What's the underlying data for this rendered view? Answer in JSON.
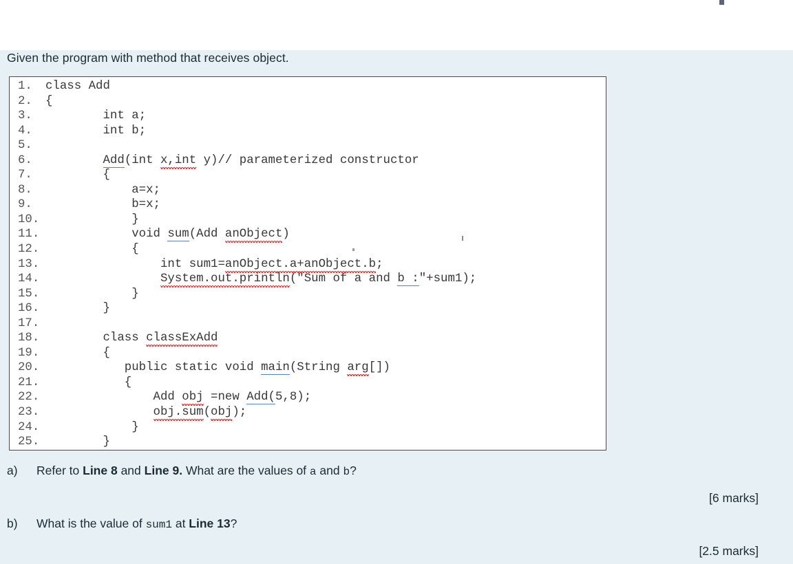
{
  "document": {
    "prompt": "Given the program with method that receives object.",
    "background_color": "#e7f1f5",
    "code_box": {
      "border_color": "#4a4a4a",
      "background_color": "#ffffff",
      "spellcheck_underline_color": "#e03a3a",
      "link_underline_color": "#4f7fc4",
      "lines": [
        {
          "num": "1.",
          "code": "class Add"
        },
        {
          "num": "2.",
          "code": "{"
        },
        {
          "num": "3.",
          "code": "        int a;"
        },
        {
          "num": "4.",
          "code": "        int b;"
        },
        {
          "num": "5.",
          "code": ""
        },
        {
          "num": "6.",
          "code": "        Add(int x,int y)// parameterized constructor"
        },
        {
          "num": "7.",
          "code": "        {"
        },
        {
          "num": "8.",
          "code": "            a=x;"
        },
        {
          "num": "9.",
          "code": "            b=x;"
        },
        {
          "num": "10.",
          "code": "            }"
        },
        {
          "num": "11.",
          "code": "            void sum(Add anObject)"
        },
        {
          "num": "12.",
          "code": "            {"
        },
        {
          "num": "13.",
          "code": "                int sum1=anObject.a+anObject.b;"
        },
        {
          "num": "14.",
          "code": "                System.out.println(\"Sum of a and b :\"+sum1);"
        },
        {
          "num": "15.",
          "code": "            }"
        },
        {
          "num": "16.",
          "code": "        }"
        },
        {
          "num": "17.",
          "code": ""
        },
        {
          "num": "18.",
          "code": "        class classExAdd"
        },
        {
          "num": "19.",
          "code": "        {"
        },
        {
          "num": "20.",
          "code": "           public static void main(String arg[])"
        },
        {
          "num": "21.",
          "code": "           {"
        },
        {
          "num": "22.",
          "code": "               Add obj =new Add(5,8);"
        },
        {
          "num": "23.",
          "code": "               obj.sum(obj);"
        },
        {
          "num": "24.",
          "code": "            }"
        },
        {
          "num": "25.",
          "code": "        }"
        }
      ]
    },
    "questions": [
      {
        "label": "a)",
        "parts": [
          {
            "text": "Refer to ",
            "style": "normal"
          },
          {
            "text": "Line 8",
            "style": "bold"
          },
          {
            "text": " and ",
            "style": "normal"
          },
          {
            "text": "Line 9.",
            "style": "bold"
          },
          {
            "text": " What are the values of ",
            "style": "normal"
          },
          {
            "text": "a",
            "style": "mono"
          },
          {
            "text": " and ",
            "style": "normal"
          },
          {
            "text": "b",
            "style": "mono"
          },
          {
            "text": "?",
            "style": "normal"
          }
        ],
        "marks": "[6 marks]"
      },
      {
        "label": "b)",
        "parts": [
          {
            "text": "What is the value of ",
            "style": "normal"
          },
          {
            "text": "sum1",
            "style": "mono"
          },
          {
            "text": " at ",
            "style": "normal"
          },
          {
            "text": "Line 13",
            "style": "bold"
          },
          {
            "text": "?",
            "style": "normal"
          }
        ],
        "marks": "[2.5 marks]"
      }
    ]
  }
}
